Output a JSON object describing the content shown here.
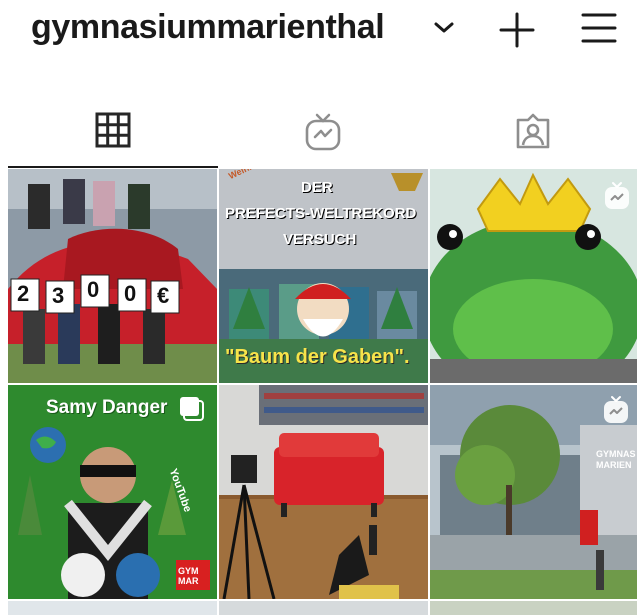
{
  "header": {
    "username": "gymnasiummarienthal",
    "icons": [
      "chevron-down-icon",
      "plus-icon",
      "menu-icon"
    ]
  },
  "tabs": [
    {
      "name": "grid",
      "icon": "grid-icon",
      "active": true
    },
    {
      "name": "igtv",
      "icon": "igtv-icon",
      "active": false
    },
    {
      "name": "tagged",
      "icon": "tagged-icon",
      "active": false
    }
  ],
  "posts": {
    "p1": {
      "digits": [
        "2",
        "3",
        "0",
        "0",
        "€"
      ]
    },
    "p2": {
      "line1": "DER",
      "line2": "PREFECTS-WELTREKORD",
      "line3": "VERSUCH",
      "bottom": "\"Baum der Gaben\".",
      "corner": "Weihnachts-"
    },
    "p3": {
      "badge_icon": "igtv-icon"
    },
    "p4": {
      "title": "Samy Danger",
      "youtube": "YouTube",
      "logo": "GYM MAR",
      "badge_icon": "multi-post-icon"
    },
    "p5": {},
    "p6": {
      "sign": "GYMNAS MARIEN",
      "badge_icon": "igtv-icon"
    }
  },
  "colors": {
    "text": "#1a1a1a",
    "icon": "#262626",
    "inactive_icon": "#8e8e8e"
  }
}
